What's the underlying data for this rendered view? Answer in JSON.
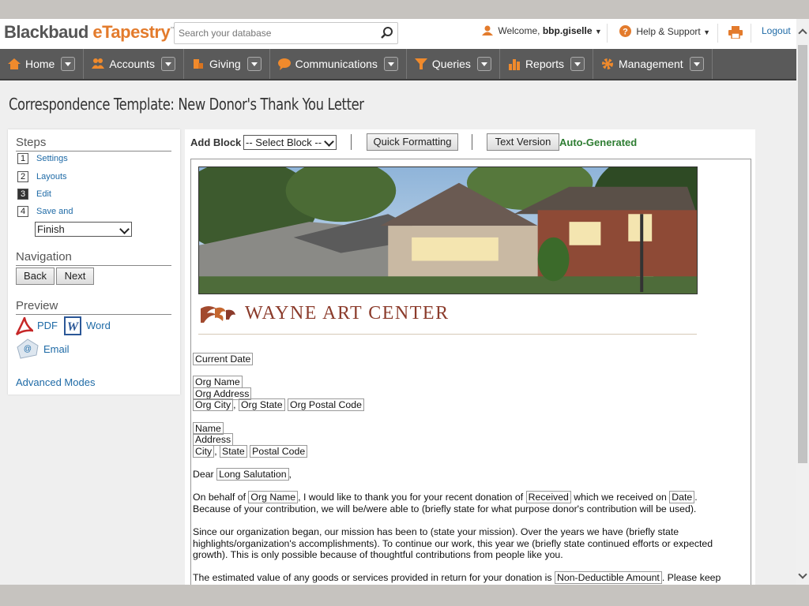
{
  "app": {
    "logo_part1": "Blackbaud",
    "logo_part2": "eTapestry",
    "logo_tm": "™"
  },
  "search": {
    "placeholder": "Search your database"
  },
  "header": {
    "welcome": "Welcome,",
    "username": "bbp.giselle",
    "help": "Help & Support",
    "logout": "Logout"
  },
  "nav": {
    "items": [
      {
        "label": "Home",
        "icon": "home-icon"
      },
      {
        "label": "Accounts",
        "icon": "accounts-icon"
      },
      {
        "label": "Giving",
        "icon": "giving-icon"
      },
      {
        "label": "Communications",
        "icon": "communications-icon"
      },
      {
        "label": "Queries",
        "icon": "queries-icon"
      },
      {
        "label": "Reports",
        "icon": "reports-icon"
      },
      {
        "label": "Management",
        "icon": "management-icon"
      }
    ]
  },
  "page": {
    "title": "Correspondence Template: New Donor's Thank You Letter"
  },
  "left": {
    "steps_heading": "Steps",
    "steps": [
      {
        "num": "1",
        "label": "Settings"
      },
      {
        "num": "2",
        "label": "Layouts"
      },
      {
        "num": "3",
        "label": "Edit"
      },
      {
        "num": "4",
        "label": "Save and"
      }
    ],
    "finish_value": "Finish",
    "navigation_heading": "Navigation",
    "back": "Back",
    "next": "Next",
    "preview_heading": "Preview",
    "pdf": "PDF",
    "word": "Word",
    "email": "Email",
    "advanced": "Advanced Modes"
  },
  "toolbar": {
    "add_block": "Add Block",
    "select_block": "-- Select Block --",
    "quick_formatting": "Quick Formatting",
    "text_version": "Text Version",
    "auto_generated": "Auto-Generated"
  },
  "letter": {
    "org_name_text": "WAYNE ART CENTER",
    "current_date": "Current Date",
    "org_name": "Org Name",
    "org_address": "Org Address",
    "org_city": "Org City",
    "org_state": "Org State",
    "org_postal": "Org Postal Code",
    "name": "Name",
    "address": "Address",
    "city": "City",
    "state": "State",
    "postal": "Postal Code",
    "comma": ",",
    "dear": "Dear",
    "long_salutation": "Long Salutation",
    "p1_a": "On behalf of",
    "p1_org": "Org Name",
    "p1_b": ", I would like to thank you for your recent donation of",
    "p1_received": "Received",
    "p1_c": "which we received on",
    "p1_date": "Date",
    "p1_d": ".",
    "p1_e": "Because of your contribution, we will be/were able to (briefly state for what purpose donor's contribution will be used).",
    "p2": "Since our organization began, our mission has been to (state your mission). Over the years we have (briefly state highlights/organization's accomplishments). To continue our work, this year we (briefly state continued efforts or expected growth). This is only possible because of thoughtful contributions from people like you.",
    "p3_a": "The estimated value of any goods or services provided in return for your donation is",
    "p3_field": "Non-Deductible Amount",
    "p3_b": ". Please keep"
  }
}
